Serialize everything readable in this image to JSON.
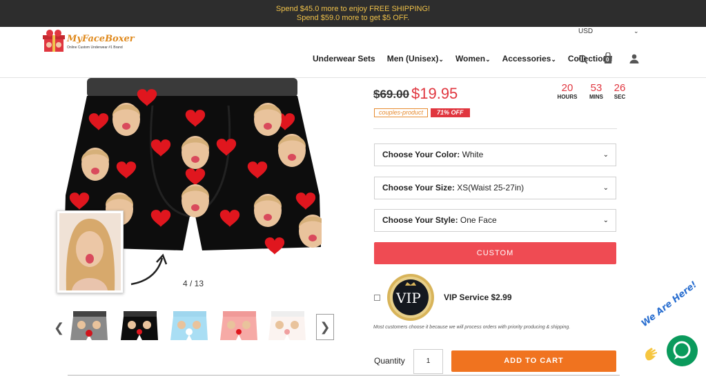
{
  "promo": {
    "line1_prefix": "Spend ",
    "line1_amount": "$45.0",
    "line1_suffix": " more to enjoy FREE SHIPPING!",
    "line2_prefix": "Spend ",
    "line2_amount": "$59.0",
    "line2_suffix": " more to get $5 OFF."
  },
  "header": {
    "brand": "MyFaceBoxer",
    "tagline": "Online Custom Underwear #1 Brand",
    "currency": "USD",
    "nav": [
      "Underwear Sets",
      "Men (Unisex)",
      "Women",
      "Accessories",
      "Collection"
    ],
    "nav_has_dropdown": [
      false,
      true,
      true,
      true,
      true
    ],
    "cart_count": "0"
  },
  "gallery": {
    "counter": "4 / 13"
  },
  "product": {
    "old_price": "$69.00",
    "new_price": "$19.95",
    "countdown": [
      {
        "value": "20",
        "label": "HOURS"
      },
      {
        "value": "53",
        "label": "MINS"
      },
      {
        "value": "26",
        "label": "SEC"
      }
    ],
    "tag_category": "couples-product",
    "tag_discount": "71% OFF",
    "options": [
      {
        "label": "Choose Your Color:",
        "value": "White"
      },
      {
        "label": "Choose Your Size:",
        "value": "XS(Waist 25-27in)"
      },
      {
        "label": "Choose Your Style:",
        "value": "One Face"
      }
    ],
    "custom_label": "CUSTOM",
    "vip_badge_text": "VIP",
    "vip_label": "VIP Service $2.99",
    "vip_note": "Most customers choose it because we will process orders with priority producing & shipping.",
    "quantity_label": "Quantity",
    "quantity_value": "1",
    "add_to_cart": "ADD TO CART"
  },
  "chat": {
    "banner": "We Are Here!"
  },
  "colors": {
    "accent_red": "#e0363f",
    "cart_orange": "#f0731f",
    "topbar_bg": "#2d2d2d",
    "promo_yellow": "#f0c24a",
    "chat_green": "#0a9a5c"
  }
}
